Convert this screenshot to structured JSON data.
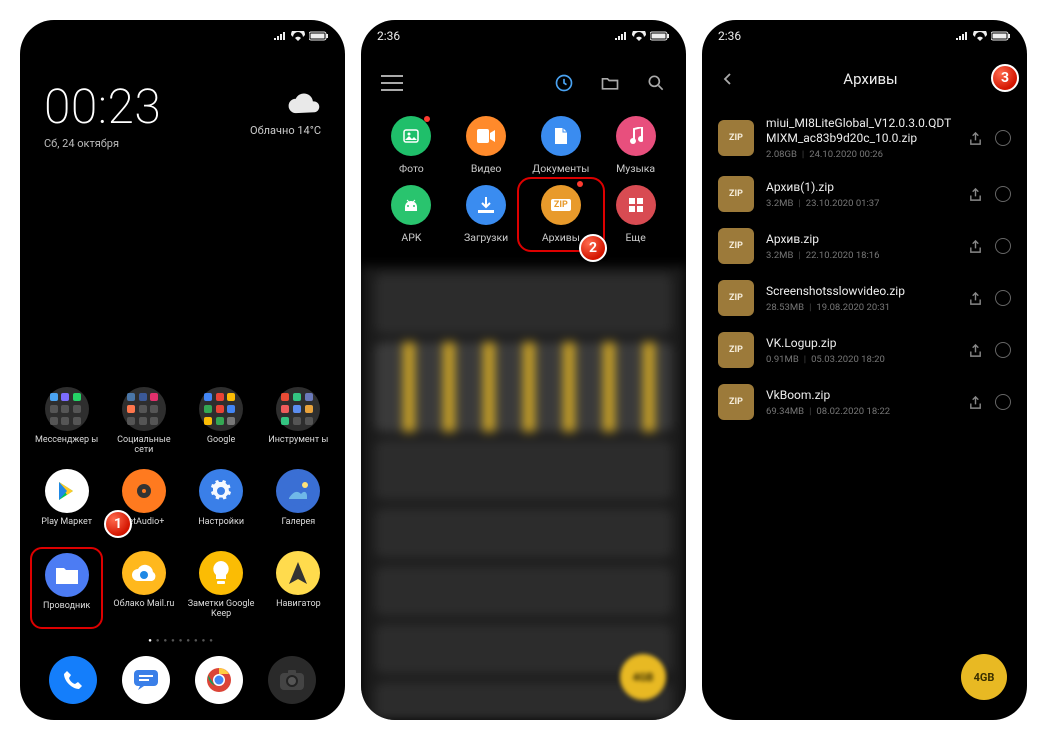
{
  "screen1": {
    "time": "00:23",
    "date": "Сб, 24 октября",
    "weather_text": "Облачно 14°C",
    "folders": [
      {
        "label": "Мессенджер\nы",
        "icon_colors": [
          "#4aa3f2",
          "#7b6cff",
          "#25d366",
          "#555",
          "#555",
          "#555",
          "#555",
          "#555",
          "#555"
        ]
      },
      {
        "label": "Социальные\nсети",
        "icon_colors": [
          "#4a76a8",
          "#3b5998",
          "#e1306c",
          "#ff764c",
          "#555",
          "#555",
          "#555",
          "#555",
          "#555"
        ]
      },
      {
        "label": "Google",
        "icon_colors": [
          "#4285f4",
          "#ea4335",
          "#fbbc05",
          "#34a853",
          "#ea4335",
          "#4285f4",
          "#fbbc05",
          "#34a853",
          "#777"
        ]
      },
      {
        "label": "Инструмент\nы",
        "icon_colors": [
          "#e94b35",
          "#33c481",
          "#6b7abb",
          "#ef5b5b",
          "#5b8def",
          "#e9a23b",
          "#33c481",
          "#555",
          "#555"
        ]
      }
    ],
    "apps_mid": [
      {
        "label": "Play Маркет",
        "bg": "#fff",
        "type": "play"
      },
      {
        "label": "JetAudio+",
        "bg": "#ff7a1f",
        "type": "jet"
      },
      {
        "label": "Настройки",
        "bg": "#3a7fe8",
        "type": "gear"
      },
      {
        "label": "Галерея",
        "bg": "#3a6fd4",
        "type": "gallery"
      }
    ],
    "apps_bot": [
      {
        "label": "Проводник",
        "bg": "#4c7cf3",
        "type": "folder",
        "highlight": true
      },
      {
        "label": "Облако\nMail.ru",
        "bg": "#ffb81d",
        "type": "cloud"
      },
      {
        "label": "Заметки\nGoogle Keep",
        "bg": "#fbbc04",
        "type": "keep"
      },
      {
        "label": "Навигатор",
        "bg": "#ffdb4d",
        "type": "nav"
      }
    ],
    "dock": [
      {
        "bg": "#147efb",
        "type": "phone"
      },
      {
        "bg": "#fff",
        "type": "sms"
      },
      {
        "bg": "#fff",
        "type": "chrome"
      },
      {
        "bg": "#2a2a2a",
        "type": "camera"
      }
    ]
  },
  "screen2": {
    "time": "2:36",
    "cats_row1": [
      {
        "label": "Фото",
        "bg": "#1fbf6a",
        "glyph": "photo",
        "notif": true
      },
      {
        "label": "Видео",
        "bg": "#ff8a2b",
        "glyph": "video"
      },
      {
        "label": "Документы",
        "bg": "#3a8cf0",
        "glyph": "doc"
      },
      {
        "label": "Музыка",
        "bg": "#e84f7d",
        "glyph": "music"
      }
    ],
    "cats_row2": [
      {
        "label": "APK",
        "bg": "#29c46e",
        "glyph": "apk"
      },
      {
        "label": "Загрузки",
        "bg": "#3a8cf0",
        "glyph": "download"
      },
      {
        "label": "Архивы",
        "bg": "#e89a2b",
        "glyph": "zip",
        "highlight": true,
        "notif": true
      },
      {
        "label": "Еще",
        "bg": "#d84b52",
        "glyph": "more"
      }
    ],
    "fab": "4GB"
  },
  "screen3": {
    "time": "2:36",
    "title": "Архивы",
    "zip_label": "ZIP",
    "files": [
      {
        "name": "miui_MI8LiteGlobal_V12.0.3.0.QDTMIXM_ac83b9d20c_10.0.zip",
        "size": "2.08GB",
        "date": "24.10.2020 00:26"
      },
      {
        "name": "Архив(1).zip",
        "size": "3.2MB",
        "date": "23.10.2020 01:37"
      },
      {
        "name": "Архив.zip",
        "size": "3.2MB",
        "date": "22.10.2020 18:16"
      },
      {
        "name": "Screenshotsslowvideo.zip",
        "size": "28.53MB",
        "date": "19.08.2020 20:31"
      },
      {
        "name": "VK.Logup.zip",
        "size": "0.91MB",
        "date": "05.03.2020 18:20"
      },
      {
        "name": "VkBoom.zip",
        "size": "69.34MB",
        "date": "08.02.2020 18:22"
      }
    ],
    "fab": "4GB"
  }
}
